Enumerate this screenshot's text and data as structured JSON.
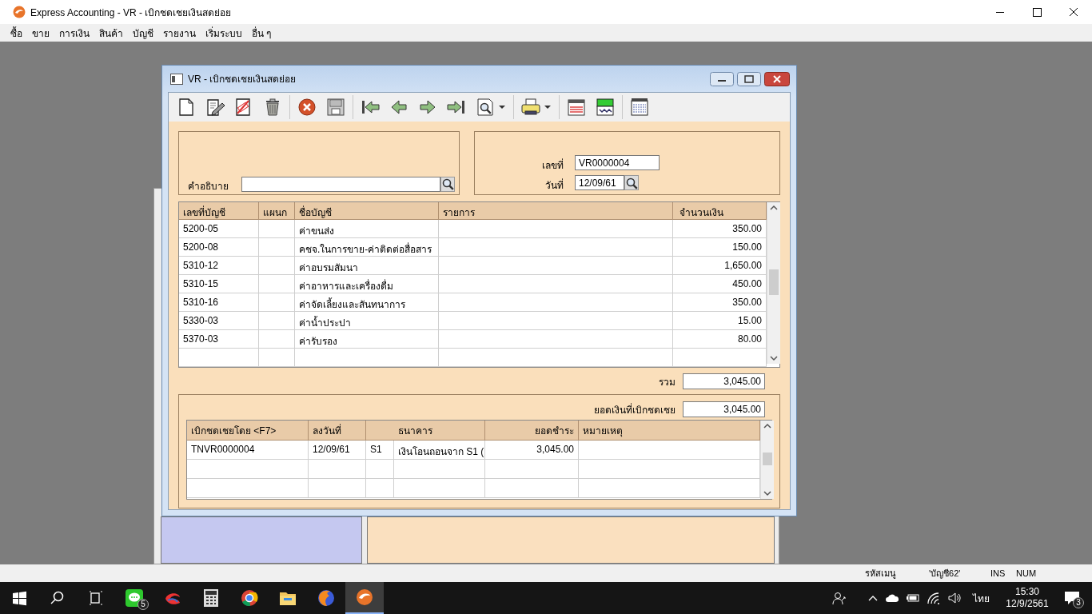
{
  "window": {
    "title": "Express Accounting - VR - เบิกชดเชยเงินสดย่อย"
  },
  "menu": [
    "ซื้อ",
    "ขาย",
    "การเงิน",
    "สินค้า",
    "บัญชี",
    "รายงาน",
    "เริ่มระบบ",
    "อื่น ๆ"
  ],
  "dialog": {
    "title": "VR - เบิกชดเชยเงินสดย่อย",
    "description_label": "คำอธิบาย",
    "doc_no_label": "เลขที่",
    "doc_no": "VR0000004",
    "date_label": "วันที่",
    "date": "12/09/61",
    "lines": {
      "columns": [
        "เลขที่บัญชี",
        "แผนก",
        "ชื่อบัญชี",
        "รายการ",
        "จำนวนเงิน"
      ],
      "rows": [
        {
          "account": "5200-05",
          "name": "ค่าขนส่ง",
          "amount": "350.00"
        },
        {
          "account": "5200-08",
          "name": "คชจ.ในการขาย-ค่าติดต่อสื่อสาร",
          "amount": "150.00"
        },
        {
          "account": "5310-12",
          "name": "ค่าอบรมสัมนา",
          "amount": "1,650.00"
        },
        {
          "account": "5310-15",
          "name": "ค่าอาหารและเครื่องดื่ม",
          "amount": "450.00"
        },
        {
          "account": "5310-16",
          "name": "ค่าจัดเลี้ยงและสันทนาการ",
          "amount": "350.00"
        },
        {
          "account": "5330-03",
          "name": "ค่าน้ำประปา",
          "amount": "15.00"
        },
        {
          "account": "5370-03",
          "name": "ค่ารับรอง",
          "amount": "80.00"
        }
      ]
    },
    "total_label": "รวม",
    "total": "3,045.00",
    "payment": {
      "label": "ยอดเงินที่เบิกชดเชย",
      "value": "3,045.00",
      "columns": [
        "เบิกชดเชยโดย <F7>",
        "ลงวันที่",
        "ธนาคาร",
        "ยอดชำระ",
        "หมายเหตุ"
      ],
      "rows": [
        {
          "doc": "TNVR0000004",
          "date": "12/09/61",
          "bank_code": "S1",
          "bank_name": "เงินโอนถอนจาก S1 (",
          "amount": "3,045.00"
        }
      ]
    }
  },
  "status_bar": [
    "รหัสเมนู",
    "'บัญชี62'",
    "INS",
    "NUM"
  ],
  "taskbar": {
    "chat_badge": "5",
    "language": "ไทย",
    "time": "15:30",
    "date": "12/9/2561",
    "notification_count": "3"
  }
}
